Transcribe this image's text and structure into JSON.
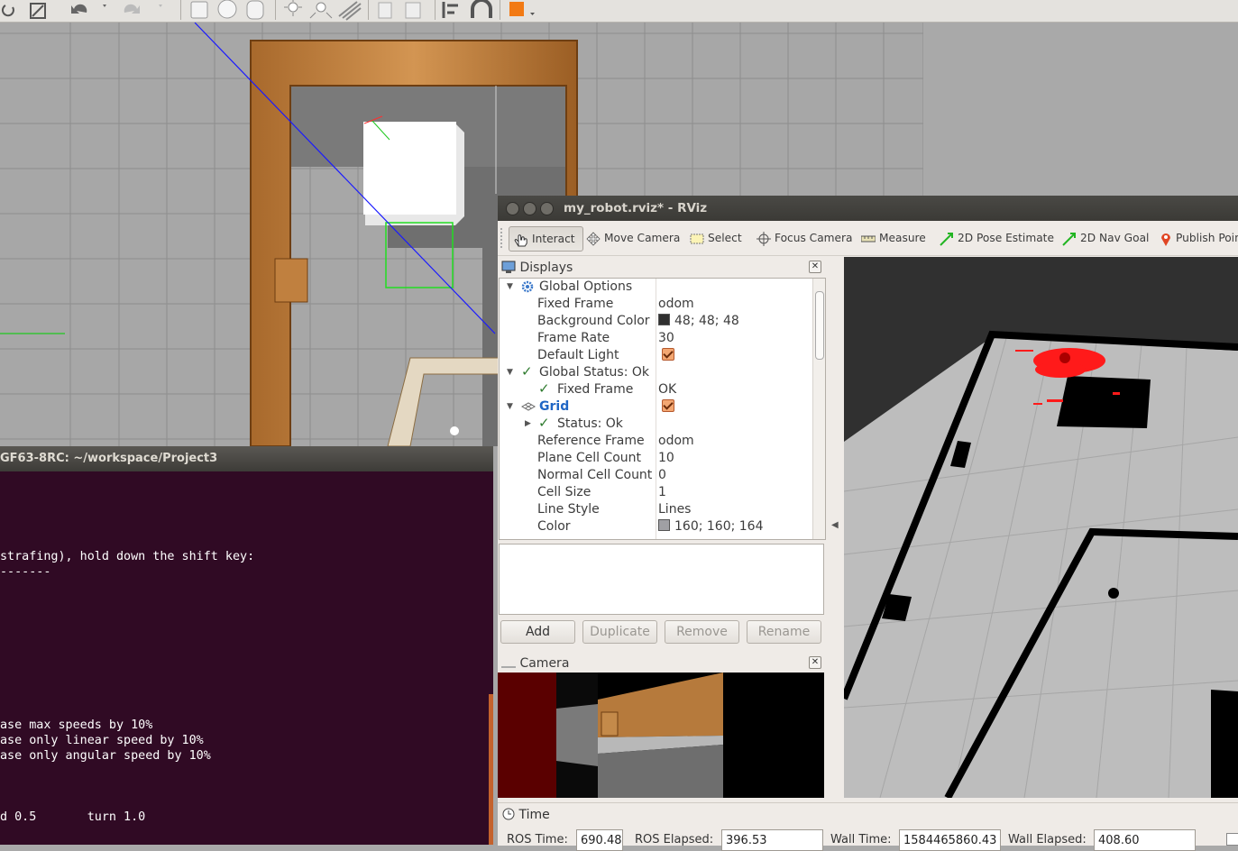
{
  "gazebo": {
    "toolbar_icons": [
      "rotate-icon",
      "scale-icon",
      "undo-icon",
      "undo-dropdown-icon",
      "redo-icon",
      "redo-dropdown-icon",
      "box-icon",
      "sphere-icon",
      "cylinder-icon",
      "point-light-icon",
      "spot-light-icon",
      "directional-light-icon",
      "copy-icon",
      "paste-icon",
      "align-icon",
      "snap-icon",
      "color-icon"
    ]
  },
  "terminal": {
    "title": "GF63-8RC: ~/workspace/Project3",
    "lines": [
      {
        "text": "strafing), hold down the shift key:",
        "row": 0
      },
      {
        "text": "-------",
        "row": 1
      },
      {
        "text": "ase max speeds by 10%",
        "row": 2
      },
      {
        "text": "ase only linear speed by 10%",
        "row": 3
      },
      {
        "text": "ase only angular speed by 10%",
        "row": 4
      },
      {
        "text": "d 0.5       turn 1.0",
        "row": 5
      }
    ],
    "background_color": "#300a24"
  },
  "rviz": {
    "title": "my_robot.rviz* - RViz",
    "tools": [
      {
        "label": "Interact",
        "icon": "hand-icon"
      },
      {
        "label": "Move Camera",
        "icon": "move-camera-icon"
      },
      {
        "label": "Select",
        "icon": "select-icon"
      },
      {
        "label": "Focus Camera",
        "icon": "focus-camera-icon"
      },
      {
        "label": "Measure",
        "icon": "ruler-icon"
      },
      {
        "label": "2D Pose Estimate",
        "icon": "green-arrow-icon"
      },
      {
        "label": "2D Nav Goal",
        "icon": "green-arrow-icon"
      },
      {
        "label": "Publish Poin",
        "icon": "map-pin-icon"
      }
    ],
    "displays": {
      "title": "Displays",
      "rows": [
        {
          "key": "Global Options",
          "value": "",
          "level": 0,
          "expanded": true
        },
        {
          "key": "Fixed Frame",
          "value": "odom",
          "level": 1
        },
        {
          "key": "Background Color",
          "value": "48; 48; 48",
          "level": 1,
          "swatch": "#303030"
        },
        {
          "key": "Frame Rate",
          "value": "30",
          "level": 1
        },
        {
          "key": "Default Light",
          "value": "",
          "level": 1,
          "checkbox": true
        },
        {
          "key": "Global Status: Ok",
          "value": "",
          "level": 0,
          "expanded": true,
          "status": "ok"
        },
        {
          "key": "Fixed Frame",
          "value": "OK",
          "level": 1,
          "status": "ok"
        },
        {
          "key": "Grid",
          "value": "",
          "level": 0,
          "expanded": true,
          "checkbox": true
        },
        {
          "key": "Status: Ok",
          "value": "",
          "level": 1,
          "status": "ok",
          "collapsed": true
        },
        {
          "key": "Reference Frame",
          "value": "odom",
          "level": 1
        },
        {
          "key": "Plane Cell Count",
          "value": "10",
          "level": 1
        },
        {
          "key": "Normal Cell Count",
          "value": "0",
          "level": 1
        },
        {
          "key": "Cell Size",
          "value": "1",
          "level": 1
        },
        {
          "key": "Line Style",
          "value": "Lines",
          "level": 1
        },
        {
          "key": "Color",
          "value": "160; 160; 164",
          "level": 1,
          "swatch": "#a0a0a4"
        }
      ],
      "buttons": {
        "add": "Add",
        "duplicate": "Duplicate",
        "remove": "Remove",
        "rename": "Rename"
      }
    },
    "camera": {
      "title": "Camera"
    },
    "time": {
      "title": "Time",
      "ros_time_label": "ROS Time:",
      "ros_time": "690.48",
      "ros_elapsed_label": "ROS Elapsed:",
      "ros_elapsed": "396.53",
      "wall_time_label": "Wall Time:",
      "wall_time": "1584465860.43",
      "wall_elapsed_label": "Wall Elapsed:",
      "wall_elapsed": "408.60"
    }
  }
}
